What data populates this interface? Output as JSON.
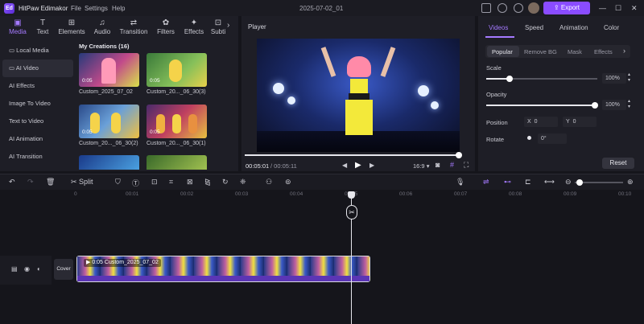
{
  "app": {
    "name": "HitPaw Edimakor",
    "logo_text": "Ed",
    "project_title": "2025-07-02_01"
  },
  "menu": [
    "File",
    "Settings",
    "Help"
  ],
  "export_label": "Export",
  "media_tabs": [
    {
      "label": "Media",
      "icon": "media-icon"
    },
    {
      "label": "Text",
      "icon": "text-icon"
    },
    {
      "label": "Elements",
      "icon": "elements-icon"
    },
    {
      "label": "Audio",
      "icon": "audio-icon"
    },
    {
      "label": "Transition",
      "icon": "transition-icon"
    },
    {
      "label": "Filters",
      "icon": "filters-icon"
    },
    {
      "label": "Effects",
      "icon": "effects-icon"
    },
    {
      "label": "Subti",
      "icon": "subtitles-icon"
    }
  ],
  "sidebar": [
    {
      "label": "Local Media"
    },
    {
      "label": "AI Video"
    },
    {
      "label": "AI Effects"
    },
    {
      "label": "Image To Video"
    },
    {
      "label": "Text to Video"
    },
    {
      "label": "AI Animation"
    },
    {
      "label": "AI Transition"
    }
  ],
  "creations": {
    "title": "My Creations (16)",
    "items": [
      {
        "label": "Custom_2025_07_02",
        "duration": "0:05"
      },
      {
        "label": "Custom_20..._06_30(3)",
        "duration": "0:05"
      },
      {
        "label": "Custom_20..._06_30(2)",
        "duration": "0:05"
      },
      {
        "label": "Custom_20..._06_30(1)",
        "duration": "0:05"
      }
    ]
  },
  "player": {
    "header": "Player",
    "current_time": "00:05:01",
    "total_time": "/ 00:05:11",
    "aspect": "16:9"
  },
  "right_panel": {
    "tabs": [
      "Videos",
      "Speed",
      "Animation",
      "Color"
    ],
    "subtabs": [
      "Popular",
      "Remove BG",
      "Mask",
      "Effects"
    ],
    "scale_label": "Scale",
    "scale_value": "100%",
    "opacity_label": "Opacity",
    "opacity_value": "100%",
    "position_label": "Position",
    "x_label": "X",
    "x_value": "0",
    "y_label": "Y",
    "y_value": "0",
    "rotate_label": "Rotate",
    "rotate_value": "0°",
    "reset_label": "Reset"
  },
  "toolbar": {
    "split_label": "Split"
  },
  "ruler_ticks": [
    "00:01",
    "00:02",
    "00:03",
    "00:04",
    "00:05",
    "00:06",
    "00:07",
    "00:08",
    "00:09",
    "00:10"
  ],
  "ruler_start": "0",
  "timeline": {
    "cover_label": "Cover",
    "clip_duration": "0:05",
    "clip_name": "Custom_2025_07_02"
  },
  "colors": {
    "accent": "#8a4cff",
    "bg": "#15151b",
    "panel": "#1e1e26"
  }
}
